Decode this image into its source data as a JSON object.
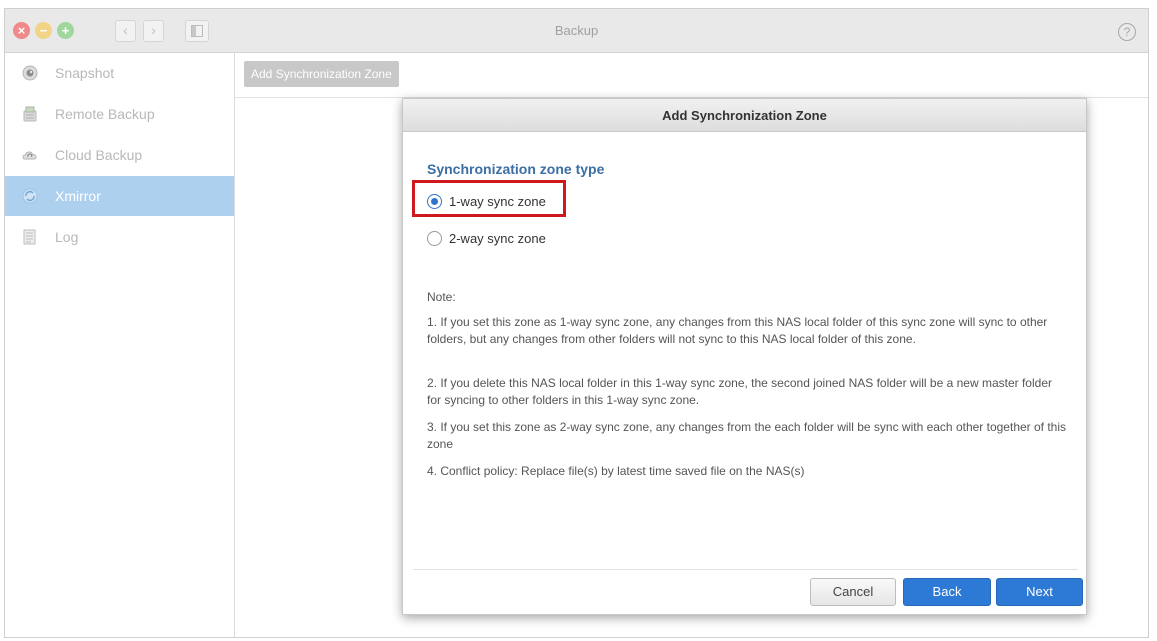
{
  "window": {
    "title": "Backup",
    "help_label": "?",
    "back_glyph": "‹",
    "forward_glyph": "›"
  },
  "sidebar": {
    "items": [
      {
        "label": "Snapshot",
        "icon": "camera-lens-icon"
      },
      {
        "label": "Remote Backup",
        "icon": "remote-backup-icon"
      },
      {
        "label": "Cloud Backup",
        "icon": "cloud-backup-icon"
      },
      {
        "label": "Xmirror",
        "icon": "xmirror-icon",
        "active": true
      },
      {
        "label": "Log",
        "icon": "log-icon"
      }
    ]
  },
  "toolbar": {
    "add_zone_label": "Add Synchronization Zone"
  },
  "dialog": {
    "title": "Add Synchronization Zone",
    "section_title": "Synchronization zone type",
    "options": [
      {
        "label": "1-way sync zone",
        "checked": true
      },
      {
        "label": "2-way sync zone",
        "checked": false
      }
    ],
    "note_title": "Note:",
    "notes": [
      "1. If you set this zone as 1-way sync zone, any changes from this NAS local folder of this sync zone will sync to other folders, but any changes from other folders will not sync to this NAS local folder of this zone.",
      "2. If you delete this NAS local folder in this 1-way sync zone, the second joined NAS folder will be a new master folder for syncing to other folders in this 1-way sync zone.",
      "3. If you set this zone as 2-way sync zone, any changes from the each folder will be sync with each other together of this zone",
      "4. Conflict policy: Replace file(s) by latest time saved file on the NAS(s)"
    ],
    "buttons": {
      "cancel": "Cancel",
      "back": "Back",
      "next": "Next"
    }
  },
  "colors": {
    "accent": "#2d7ad6",
    "sidebar_active": "#aed0ef",
    "highlight": "#d0191f",
    "section_title": "#3a6ea5"
  }
}
